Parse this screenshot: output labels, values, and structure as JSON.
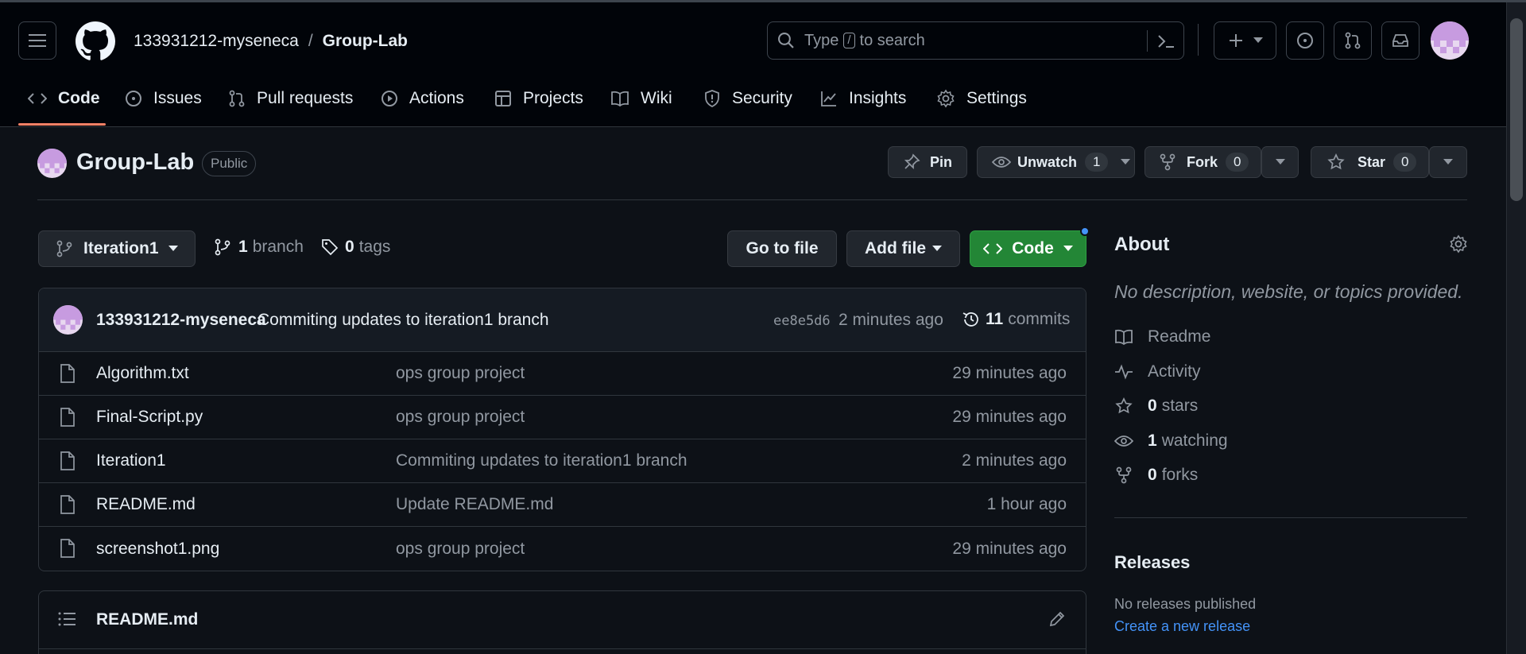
{
  "header": {
    "owner": "133931212-myseneca",
    "separator": "/",
    "repo": "Group-Lab",
    "search_prefix": "Type",
    "search_key": "/",
    "search_suffix": "to search"
  },
  "nav": {
    "tabs": [
      {
        "label": "Code",
        "icon": "code-icon"
      },
      {
        "label": "Issues",
        "icon": "issue-icon"
      },
      {
        "label": "Pull requests",
        "icon": "pull-request-icon"
      },
      {
        "label": "Actions",
        "icon": "play-icon"
      },
      {
        "label": "Projects",
        "icon": "table-icon"
      },
      {
        "label": "Wiki",
        "icon": "book-icon"
      },
      {
        "label": "Security",
        "icon": "shield-icon"
      },
      {
        "label": "Insights",
        "icon": "graph-icon"
      },
      {
        "label": "Settings",
        "icon": "gear-icon"
      }
    ]
  },
  "repo": {
    "name": "Group-Lab",
    "visibility": "Public",
    "pin_label": "Pin",
    "unwatch_label": "Unwatch",
    "watch_count": "1",
    "fork_label": "Fork",
    "fork_count": "0",
    "star_label": "Star",
    "star_count": "0"
  },
  "toolbar": {
    "branch": "Iteration1",
    "branch_count": "1",
    "branch_word": "branch",
    "tag_count": "0",
    "tag_word": "tags",
    "goto_file": "Go to file",
    "add_file": "Add file",
    "code": "Code"
  },
  "commit": {
    "author": "133931212-myseneca",
    "message": "Commiting updates to iteration1 branch",
    "sha": "ee8e5d6",
    "time": "2 minutes ago",
    "count": "11",
    "count_word": "commits"
  },
  "files": [
    {
      "name": "Algorithm.txt",
      "message": "ops group project",
      "date": "29 minutes ago"
    },
    {
      "name": "Final-Script.py",
      "message": "ops group project",
      "date": "29 minutes ago"
    },
    {
      "name": "Iteration1",
      "message": "Commiting updates to iteration1 branch",
      "date": "2 minutes ago"
    },
    {
      "name": "README.md",
      "message": "Update README.md",
      "date": "1 hour ago"
    },
    {
      "name": "screenshot1.png",
      "message": "ops group project",
      "date": "29 minutes ago"
    }
  ],
  "readme": {
    "title": "README.md"
  },
  "about": {
    "title": "About",
    "description": "No description, website, or topics provided.",
    "readme": "Readme",
    "activity": "Activity",
    "stars_count": "0",
    "stars_word": "stars",
    "watching_count": "1",
    "watching_word": "watching",
    "forks_count": "0",
    "forks_word": "forks"
  },
  "releases": {
    "title": "Releases",
    "none": "No releases published",
    "create": "Create a new release"
  },
  "colors": {
    "background": "#0d1117",
    "header": "#010409",
    "accent_green": "#238636",
    "link_blue": "#4493f8",
    "tab_underline": "#f78166"
  }
}
